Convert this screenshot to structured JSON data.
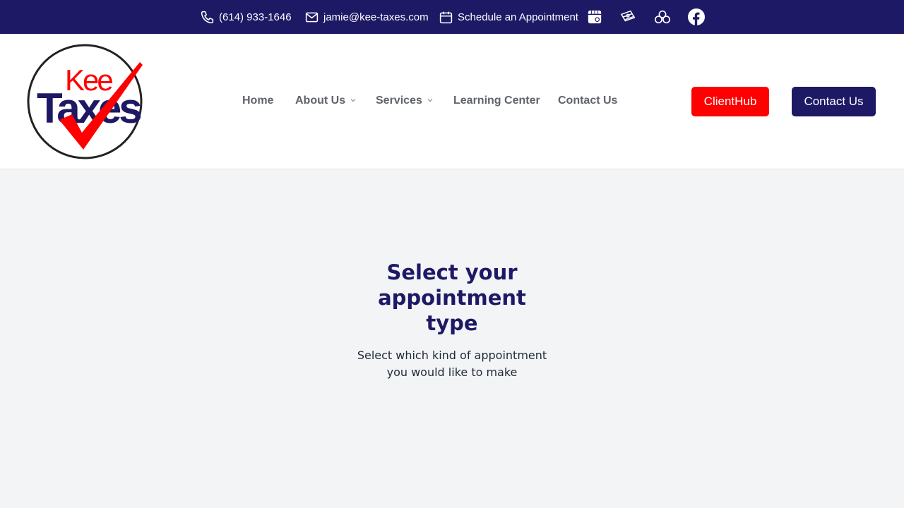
{
  "topbar": {
    "phone": "(614) 933-1646",
    "email": "jamie@kee-taxes.com",
    "schedule": "Schedule an Appointment",
    "icons": [
      "phone-icon",
      "mail-icon",
      "calendar-icon",
      "store-icon",
      "money-icon",
      "cloud-icon",
      "facebook-icon"
    ]
  },
  "logo": {
    "line1": "Kee",
    "line2": "Taxes"
  },
  "nav": {
    "home": "Home",
    "about": "About Us",
    "services": "Services",
    "learning": "Learning Center",
    "contact": "Contact Us"
  },
  "buttons": {
    "clienthub": "ClientHub",
    "contact": "Contact Us"
  },
  "main": {
    "title_line1": "Select your",
    "title_line2": "appointment",
    "title_line3": "type",
    "subtitle_line1": "Select which kind of appointment",
    "subtitle_line2": "you would like to make"
  },
  "colors": {
    "navy": "#1e1965",
    "red": "#ff0000",
    "background": "#f3f4f6",
    "nav_text": "#5f636b"
  }
}
